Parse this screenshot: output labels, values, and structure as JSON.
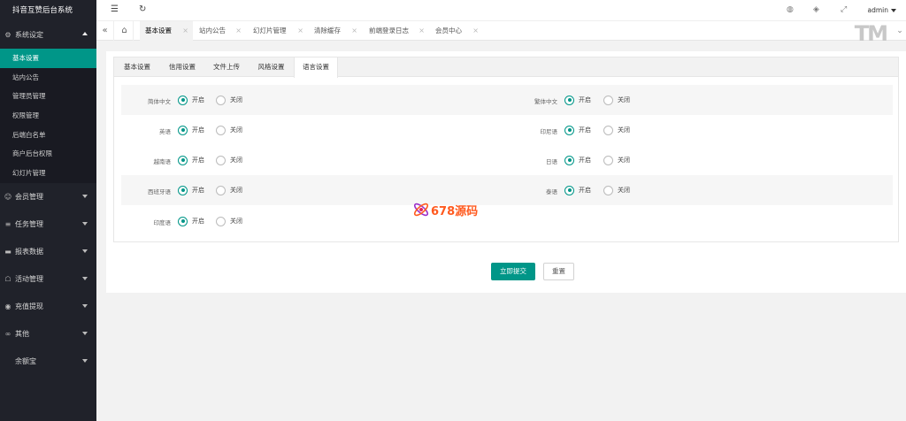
{
  "app": {
    "title": "抖音互赞后台系统"
  },
  "sidebar": {
    "groups": [
      {
        "label": "系统设定",
        "icon": "gear-icon",
        "expanded": true,
        "items": [
          {
            "label": "基本设置",
            "active": true
          },
          {
            "label": "站内公告"
          },
          {
            "label": "管理员管理"
          },
          {
            "label": "权限管理"
          },
          {
            "label": "后端白名单"
          },
          {
            "label": "商户后台权限"
          },
          {
            "label": "幻灯片管理"
          }
        ]
      },
      {
        "label": "会员管理",
        "icon": "users-icon"
      },
      {
        "label": "任务管理",
        "icon": "task-icon"
      },
      {
        "label": "报表数据",
        "icon": "report-icon"
      },
      {
        "label": "活动管理",
        "icon": "activity-icon"
      },
      {
        "label": "充值提现",
        "icon": "money-icon"
      },
      {
        "label": "其他",
        "icon": "link-icon"
      },
      {
        "label": "余额宝",
        "icon": ""
      }
    ]
  },
  "header": {
    "user": "admin"
  },
  "page_tabs": [
    {
      "label": "基本设置",
      "active": true
    },
    {
      "label": "站内公告"
    },
    {
      "label": "幻灯片管理"
    },
    {
      "label": "清除缓存"
    },
    {
      "label": "前端登录日志"
    },
    {
      "label": "会员中心"
    }
  ],
  "logo_text": "TM",
  "settings_tabs": [
    "基本设置",
    "信用设置",
    "文件上传",
    "风格设置",
    "语言设置"
  ],
  "active_settings_tab": 4,
  "radio_labels": {
    "on": "开启",
    "off": "关闭"
  },
  "languages": [
    {
      "name": "简体中文",
      "enabled": true
    },
    {
      "name": "繁体中文",
      "enabled": true
    },
    {
      "name": "英语",
      "enabled": true
    },
    {
      "name": "印尼语",
      "enabled": true
    },
    {
      "name": "越南语",
      "enabled": true
    },
    {
      "name": "日语",
      "enabled": true
    },
    {
      "name": "西班牙语",
      "enabled": true
    },
    {
      "name": "泰语",
      "enabled": true
    },
    {
      "name": "印度语",
      "enabled": true
    }
  ],
  "buttons": {
    "submit": "立即提交",
    "reset": "重置"
  },
  "watermark": {
    "text": "678源码"
  },
  "colors": {
    "accent": "#009688",
    "sidebar_bg": "#20222a"
  }
}
